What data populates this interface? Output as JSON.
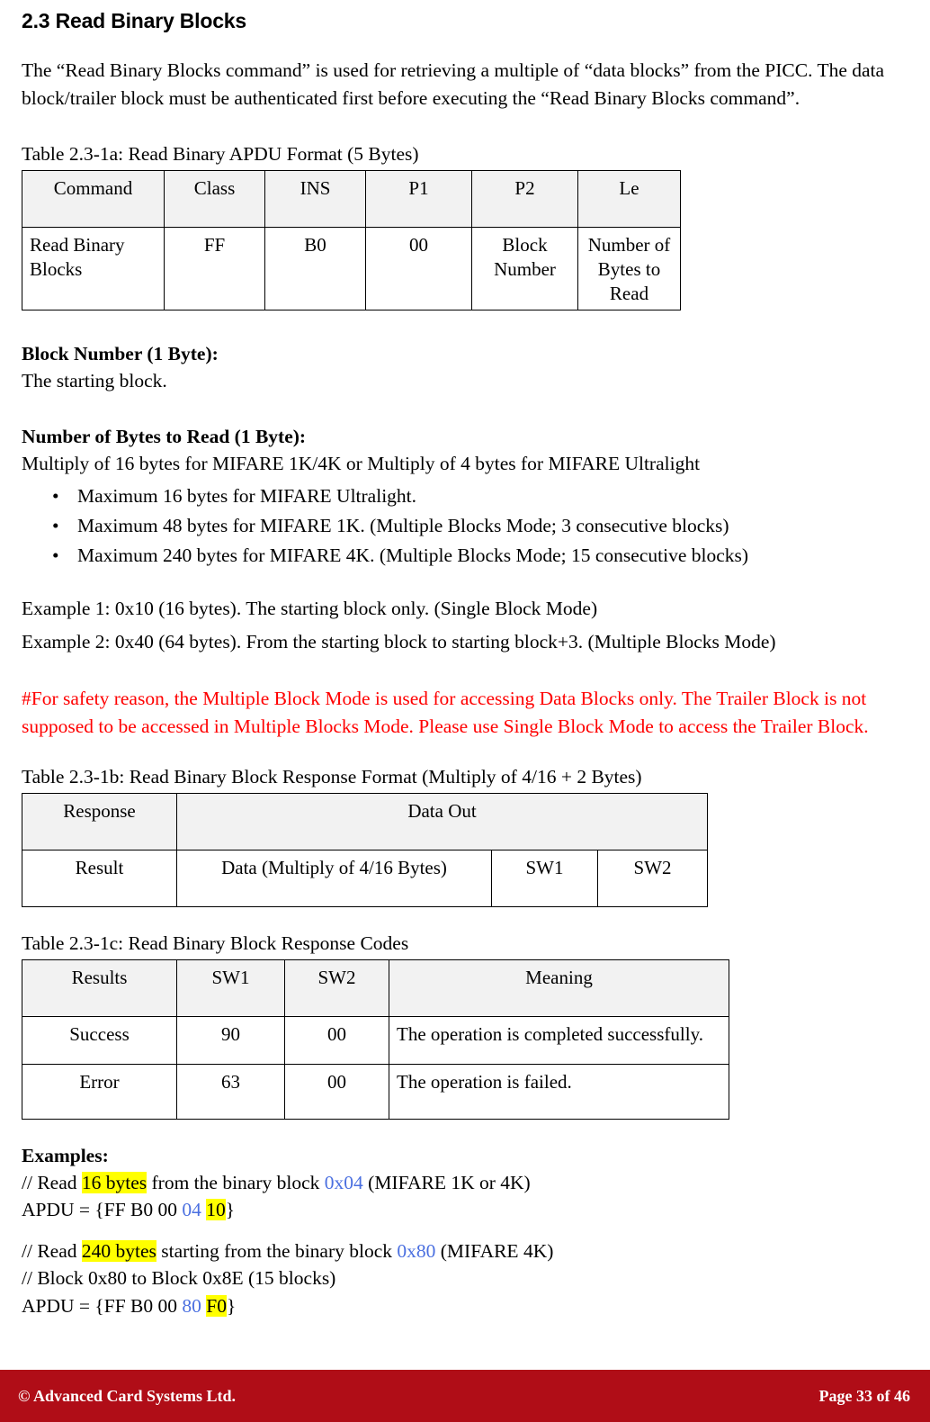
{
  "section": {
    "title": "2.3 Read Binary Blocks",
    "intro": "The “Read Binary Blocks command” is used for retrieving a multiple of “data blocks” from the PICC. The data block/trailer block must be authenticated first before executing the “Read Binary Blocks command”."
  },
  "table_a": {
    "caption": "Table 2.3-1a: Read Binary APDU Format (5 Bytes)",
    "headers": [
      "Command",
      "Class",
      "INS",
      "P1",
      "P2",
      "Le"
    ],
    "row": [
      "Read Binary Blocks",
      "FF",
      "B0",
      "00",
      "Block Number",
      "Number of Bytes to Read"
    ]
  },
  "block_number": {
    "heading": "Block Number (1 Byte):",
    "text": "The starting block."
  },
  "bytes_to_read": {
    "heading": "Number of Bytes to Read (1 Byte):",
    "text": "Multiply of 16 bytes for MIFARE 1K/4K or Multiply of 4 bytes for MIFARE Ultralight",
    "bullet_glyph": "•",
    "bullets": [
      "Maximum 16 bytes for MIFARE Ultralight.",
      "Maximum 48 bytes for MIFARE 1K. (Multiple Blocks Mode; 3 consecutive blocks)",
      "Maximum 240 bytes for MIFARE 4K. (Multiple Blocks Mode; 15 consecutive blocks)"
    ]
  },
  "examples_inline": {
    "example1": "Example 1: 0x10 (16 bytes). The starting block only. (Single Block Mode)",
    "example2": "Example 2: 0x40 (64 bytes). From the starting block to starting block+3. (Multiple Blocks Mode)"
  },
  "warning": {
    "text": "#For safety reason, the Multiple Block Mode is used for accessing Data Blocks only. The Trailer Block is not supposed to be accessed in Multiple Blocks Mode. Please use Single Block Mode to access the Trailer Block.",
    "color": "#ff0000"
  },
  "table_b": {
    "caption": "Table 2.3-1b: Read Binary Block Response Format (Multiply of 4/16 + 2 Bytes)",
    "headers": [
      "Response",
      "Data Out"
    ],
    "row": [
      "Result",
      "Data (Multiply of 4/16 Bytes)",
      "SW1",
      "SW2"
    ]
  },
  "table_c": {
    "caption": "Table 2.3-1c: Read Binary Block Response Codes",
    "headers": [
      "Results",
      "SW1",
      "SW2",
      "Meaning"
    ],
    "rows": [
      [
        "Success",
        "90",
        "00",
        "The operation is completed successfully."
      ],
      [
        "Error",
        "63",
        "00",
        "The operation is failed."
      ]
    ]
  },
  "examples": {
    "heading": "Examples:",
    "highlight_color": "#ffff00",
    "hex_color": "#4a6fe0",
    "line1": {
      "pre": "// Read ",
      "hl1": "16 bytes",
      "mid": " from the binary block ",
      "blue1": "0x04",
      "post": " (MIFARE 1K or 4K)"
    },
    "line2": {
      "pre": "APDU = {FF B0 00 ",
      "blue1": "04",
      "sp": " ",
      "hl1": "10",
      "post": "}"
    },
    "line3": {
      "pre": "// Read ",
      "hl1": "240 bytes",
      "mid": " starting from the binary block ",
      "blue1": "0x80",
      "post": " (MIFARE 4K)"
    },
    "line4": "// Block 0x80 to Block 0x8E (15 blocks)",
    "line5": {
      "pre": "APDU = {FF B0 00 ",
      "blue1": "80",
      "sp": " ",
      "hl1": "F0",
      "post": "}"
    }
  },
  "footer": {
    "copyright": "© Advanced Card Systems Ltd.",
    "page": "Page 33 of 46",
    "background": "#b00d17"
  }
}
